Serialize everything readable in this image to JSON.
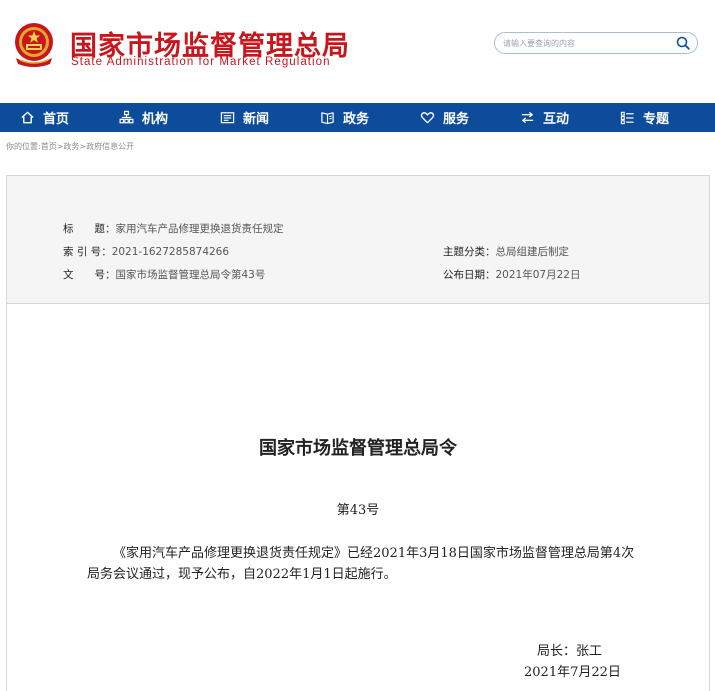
{
  "header": {
    "site_title": "国家市场监督管理总局",
    "site_subtitle": "State Administration for Market Regulation",
    "brand_color": "#c8161d",
    "search": {
      "placeholder": "请输入要查询的内容"
    }
  },
  "nav": {
    "color": "#0d4c9a",
    "items": [
      {
        "label": "首页",
        "icon": "home-icon"
      },
      {
        "label": "机构",
        "icon": "org-chart-icon"
      },
      {
        "label": "新闻",
        "icon": "news-icon"
      },
      {
        "label": "政务",
        "icon": "government-affairs-icon"
      },
      {
        "label": "服务",
        "icon": "heart-icon"
      },
      {
        "label": "互动",
        "icon": "exchange-arrows-icon"
      },
      {
        "label": "专题",
        "icon": "topics-list-icon"
      }
    ]
  },
  "breadcrumb": "你的位置:首页>政务>政府信息公开",
  "meta": {
    "title_label": "标　　题",
    "title_value": "家用汽车产品修理更换退货责任规定",
    "index_label": "索 引 号",
    "index_value": "2021-1627285874266",
    "doc_no_label": "文　　号",
    "doc_no_value": "国家市场监督管理总局令第43号",
    "category_label": "主题分类",
    "category_value": "总局组建后制定",
    "date_label": "公布日期",
    "date_value": "2021年07月22日",
    "separator": "："
  },
  "document": {
    "title": "国家市场监督管理总局令",
    "number": "第43号",
    "body": "《家用汽车产品修理更换退货责任规定》已经2021年3月18日国家市场监督管理总局第4次局务会议通过，现予公布，自2022年1月1日起施行。",
    "signer": "局长：张工",
    "date": "2021年7月22日"
  }
}
